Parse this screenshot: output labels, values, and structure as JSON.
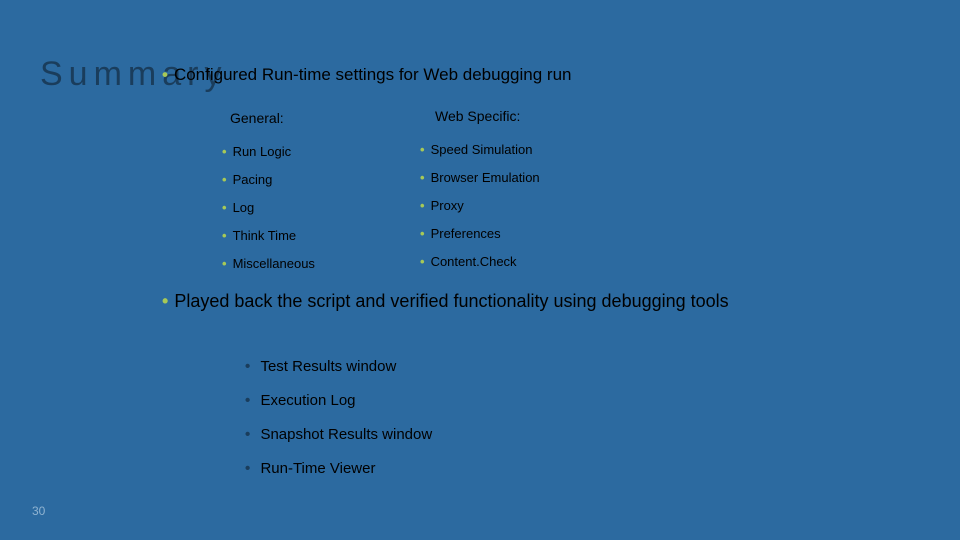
{
  "title": "Summary",
  "main_bullet_1": "Configured Run-time settings for Web debugging run",
  "columns": {
    "general_header": "General:",
    "web_header": "Web Specific:"
  },
  "general_items": {
    "i0": "Run Logic",
    "i1": "Pacing",
    "i2": "Log",
    "i3": "Think Time",
    "i4": "Miscellaneous"
  },
  "web_items": {
    "i0": "Speed Simulation",
    "i1": "Browser Emulation",
    "i2": "Proxy",
    "i3": "Preferences",
    "i4": "Content.Check"
  },
  "main_bullet_2": "Played back the script and verified functionality using debugging tools",
  "tools": {
    "t0": "Test Results window",
    "t1": "Execution Log",
    "t2": "Snapshot Results window",
    "t3": "Run-Time Viewer"
  },
  "page_number": "30"
}
